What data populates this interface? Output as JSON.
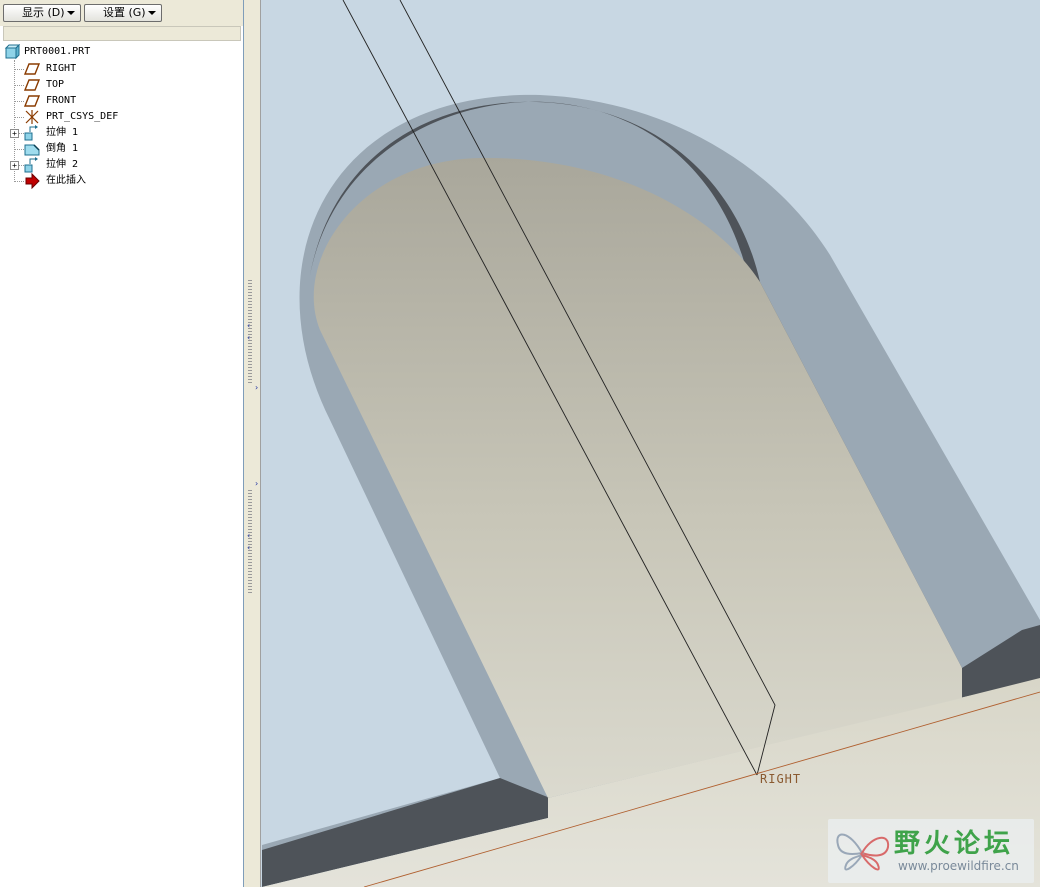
{
  "toolbar": {
    "show_label": "显示 (D)",
    "settings_label": "设置 (G)"
  },
  "model_tree": {
    "root": "PRT0001.PRT",
    "items": [
      {
        "label": "RIGHT",
        "icon": "datum-plane-icon"
      },
      {
        "label": "TOP",
        "icon": "datum-plane-icon"
      },
      {
        "label": "FRONT",
        "icon": "datum-plane-icon"
      },
      {
        "label": "PRT_CSYS_DEF",
        "icon": "coordinate-system-icon"
      },
      {
        "label": "拉伸 1",
        "icon": "extrude-icon",
        "expandable": true
      },
      {
        "label": "倒角 1",
        "icon": "chamfer-icon"
      },
      {
        "label": "拉伸 2",
        "icon": "extrude-icon",
        "expandable": true
      },
      {
        "label": "在此插入",
        "icon": "insert-here-arrow-icon"
      }
    ]
  },
  "viewport": {
    "datum_label": "RIGHT",
    "background_color": "#c8d7e3",
    "model_face_color": "#cfcdbf",
    "model_side_color": "#9aa8b4",
    "model_wall_color": "#4e5359",
    "datum_line_color": "#b06030"
  },
  "watermark": {
    "title": "野火论坛",
    "url": "www.proewildfire.cn"
  }
}
